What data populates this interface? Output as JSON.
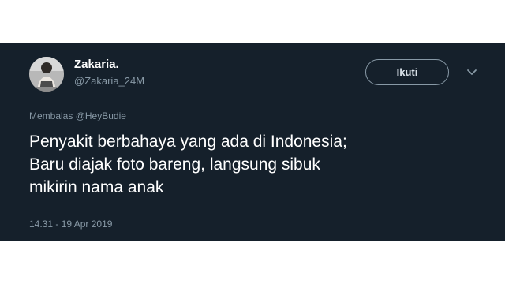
{
  "tweet": {
    "display_name": "Zakaria.",
    "username": "@Zakaria_24M",
    "follow_label": "Ikuti",
    "reply_prefix": "Membalas",
    "reply_handle": "@HeyBudie",
    "text_lines": [
      "Penyakit berbahaya yang ada di Indonesia;",
      "Baru diajak foto bareng, langsung sibuk",
      "mikirin nama anak"
    ],
    "timestamp": "14.31 - 19 Apr 2019"
  },
  "icons": {
    "avatar": "avatar-photo",
    "menu": "chevron-down-icon"
  },
  "colors": {
    "card_background": "#15202b",
    "page_background": "#ffffff",
    "primary_text": "#ffffff",
    "secondary_text": "#8899a6",
    "button_border": "#8899a6"
  }
}
